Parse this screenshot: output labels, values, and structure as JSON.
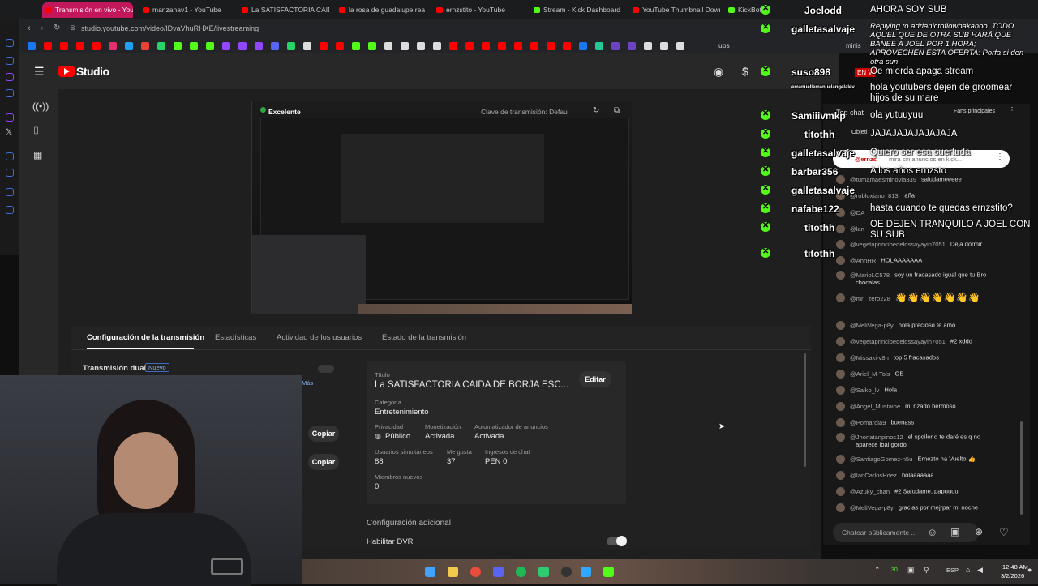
{
  "browser": {
    "tabs": [
      "Transmisión en vivo - YouT",
      "manzanav1 - YouTube",
      "La SATISFACTORIA CAIDA",
      "la rosa de guadalupe reac",
      "ernzstito - YouTube",
      "Stream - Kick Dashboard",
      "YouTube Thumbnail Down",
      "KickBot"
    ],
    "url": "studio.youtube.com/video/lDvaVhuRHXE/livestreaming",
    "bookmark_extra": "ups",
    "bookmark_extra2": "minis"
  },
  "studio": {
    "logo_text": "Studio",
    "live_badge": "EN V",
    "preview": {
      "quality": "Excelente",
      "stream_key": "Clave de transmisión: Defau"
    },
    "tabs": [
      "Configuración de la transmisión",
      "Estadísticas",
      "Actividad de los usuarios",
      "Estado de la transmisión"
    ],
    "dual": {
      "label": "Transmisión dual",
      "badge": "Nuevo",
      "more": "Más"
    },
    "copy1": "Copiar",
    "copy2": "Copiar",
    "info": {
      "title_label": "Título",
      "title": "La SATISFACTORIA CAIDA DE BORJA ESC...",
      "edit": "Editar",
      "category_label": "Categoría",
      "category": "Entretenimiento",
      "privacy_label": "Privacidad",
      "privacy": "Público",
      "monet_label": "Monetización",
      "monet": "Activada",
      "ads_label": "Automatizador de anuncios",
      "ads": "Activada",
      "viewers_label": "Usuarios simultáneos",
      "viewers": "88",
      "likes_label": "Me gusta",
      "likes": "37",
      "income_label": "Ingresos de chat",
      "income": "PEN 0",
      "members_label": "Miembros nuevos",
      "members": "0"
    },
    "additional": "Configuración adicional",
    "dvr": "Habilitar DVR"
  },
  "ytchat": {
    "header_top": "Top chat",
    "fans": "Fans principales",
    "objective": "Objeti",
    "pinned_user": "@ernzs",
    "pinned_text": "mira sin anuncios en kick...",
    "messages": [
      {
        "user": "@tumamaesminovia339",
        "text": "saludameeeee"
      },
      {
        "user": "@robloxiano_813i",
        "text": "aña"
      },
      {
        "user": "@DA",
        "text": ""
      },
      {
        "user": "@lan",
        "text": ""
      },
      {
        "user": "@vegetaprincipedelossayayin7051",
        "text": "Deja dormir"
      },
      {
        "user": "@AnnHR",
        "text": "HOLAAAAAAA"
      },
      {
        "user": "@MarioLC578",
        "text": "soy un fracasado igual que tu Bro"
      },
      {
        "user": "",
        "text": "chocalas"
      },
      {
        "user": "@mrj_zero228",
        "text": "👋👋👋👋👋👋👋"
      },
      {
        "user": "@MeliVega-p8y",
        "text": "hola precioso te amo"
      },
      {
        "user": "@vegetaprincipedelossayayin7051",
        "text": "#2 xddd"
      },
      {
        "user": "@Missaki-v8n",
        "text": "top 5 fracasados"
      },
      {
        "user": "@Ariel_M-Tois",
        "text": "OE"
      },
      {
        "user": "@Saiko_lv",
        "text": "Hola"
      },
      {
        "user": "@Angel_Mustaine",
        "text": "mi rizado hermoso"
      },
      {
        "user": "@Pomarola9",
        "text": "buenass"
      },
      {
        "user": "@Jhonatanpinos12",
        "text": "el spoiler q te daré es q no"
      },
      {
        "user": "",
        "text": "aparece ibai gordo"
      },
      {
        "user": "@SantiagoGomez-n5u",
        "text": "Ernezto ha Vuelto 👍"
      },
      {
        "user": "@IanCarlosHdez",
        "text": "holaaaaaaa"
      },
      {
        "user": "@Azuky_chan",
        "text": "#2 Saludame, papuuuu"
      },
      {
        "user": "@MeliVega-p8y",
        "text": "gracias por mejrpar mi noche"
      }
    ],
    "input_placeholder": "Chatear públicamente ..."
  },
  "kick_overlay": {
    "users": [
      "Joelodd",
      "galletasalvaje",
      "suso898",
      "emanuellemanuelangelalev",
      "Samiiivmkp",
      "titothh",
      "galletasalvaje",
      "barbar356",
      "galletasalvaje",
      "nafabe122",
      "titothh",
      "titothh"
    ],
    "messages": [
      "AHORA SOY SUB",
      "Replying to adrianictoflowbakanoo: TODO AQUEL QUE DE OTRA SUB HARÁ QUE BANEE A JOEL POR 1 HORA; APROVECHEN ESTA OFERTA: Porfa si den otra sun",
      "Oe mierda apaga stream",
      "hola youtubers dejen de groomear hijos de su mare",
      "ola yutuuyuu",
      "JAJAJAJAJAJAJAJA",
      "Quiero ser esa suertuda",
      "A los años ernzsto",
      "hasta cuando te quedas ernzstito?",
      "OE DEJEN TRANQUILO A JOEL CON SU SUB"
    ]
  },
  "taskbar": {
    "lang": "ESP",
    "time": "12:48 AM",
    "date": "3/2/2026",
    "badge": "30"
  }
}
